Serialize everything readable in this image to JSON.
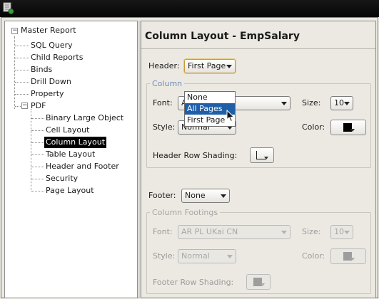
{
  "tree": {
    "root": "Master Report",
    "items": [
      "SQL Query",
      "Child Reports",
      "Binds",
      "Drill Down",
      "Property"
    ],
    "pdf": {
      "label": "PDF",
      "children": [
        "Binary Large Object",
        "Cell Layout",
        "Column Layout",
        "Table Layout",
        "Header and Footer",
        "Security",
        "Page Layout"
      ],
      "selected": "Column Layout"
    }
  },
  "panel": {
    "title": "Column Layout - EmpSalary",
    "header_label": "Header:",
    "header_value": "First Page",
    "header_options": [
      "None",
      "All Pages",
      "First Page"
    ],
    "header_highlighted": "All Pages",
    "column_group": "Column",
    "font_label": "Font:",
    "font_value": "AR",
    "size_label": "Size:",
    "size_value": "10",
    "style_label": "Style:",
    "style_value": "Normal",
    "color_label": "Color:",
    "header_shading_label": "Header Row Shading:",
    "footer_label": "Footer:",
    "footer_value": "None",
    "footings_group": "Column Footings",
    "footing_font_label": "Font:",
    "footing_font_value": "AR PL UKai CN",
    "footing_size_label": "Size:",
    "footing_size_value": "10",
    "footing_style_label": "Style:",
    "footing_style_value": "Normal",
    "footing_color_label": "Color:",
    "footer_shading_label": "Footer Row Shading:"
  },
  "colors": {
    "titlebar": "#0b0b0b",
    "selection": "#000000",
    "highlight": "#1f5fa8",
    "group_title": "#6e8bb3"
  }
}
